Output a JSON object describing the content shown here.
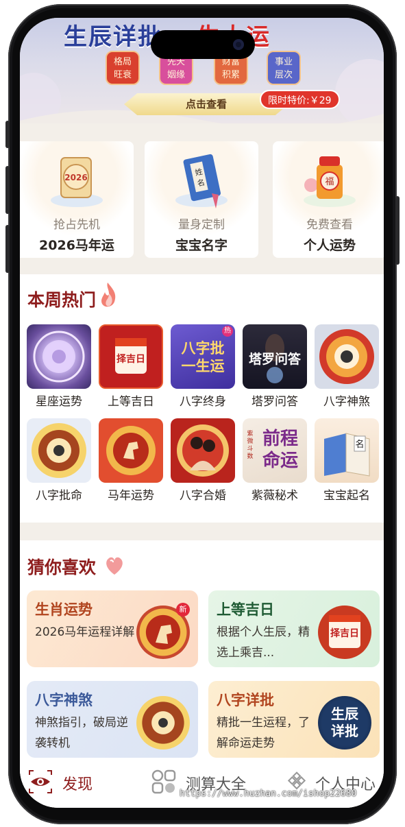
{
  "banner": {
    "title_part1": "生辰详批",
    "title_part2": "一生大运",
    "tags": [
      {
        "line1": "格局",
        "line2": "旺衰"
      },
      {
        "line1": "先天",
        "line2": "姻缘"
      },
      {
        "line1": "财富",
        "line2": "积累"
      },
      {
        "line1": "事业",
        "line2": "层次"
      }
    ],
    "button_label": "点击查看",
    "price_label": "限时特价:￥29"
  },
  "feature_cards": [
    {
      "subtitle": "抢占先机",
      "title": "2026马年运",
      "art_text": "2026"
    },
    {
      "subtitle": "量身定制",
      "title": "宝宝名字",
      "art_text": "姓名"
    },
    {
      "subtitle": "免费查看",
      "title": "个人运势",
      "art_text": "福"
    }
  ],
  "hot": {
    "title": "本周热门",
    "items": [
      {
        "label": "星座运势",
        "icon": "zodiac-wheel-icon"
      },
      {
        "label": "上等吉日",
        "icon": "calendar-icon",
        "icon_text": "择吉日"
      },
      {
        "label": "八字终身",
        "icon": "bazi-book-icon",
        "icon_text": "八字批一生运",
        "badge": "热"
      },
      {
        "label": "塔罗问答",
        "icon": "tarot-icon",
        "icon_text": "塔罗问答"
      },
      {
        "label": "八字神煞",
        "icon": "bagua-wheel-icon"
      },
      {
        "label": "八字批命",
        "icon": "yinyang-icon"
      },
      {
        "label": "马年运势",
        "icon": "horse-icon"
      },
      {
        "label": "八字合婚",
        "icon": "couple-icon"
      },
      {
        "label": "紫薇秘术",
        "icon": "fortune-icon",
        "icon_text": "前程命运",
        "icon_side_text": "紫微斗数"
      },
      {
        "label": "宝宝起名",
        "icon": "name-book-icon",
        "icon_text": "名"
      }
    ]
  },
  "guess": {
    "title": "猜你喜欢",
    "cards": [
      {
        "title": "生肖运势",
        "desc": "2026马年运程详解",
        "icon": "horse-icon",
        "badge": "新"
      },
      {
        "title": "上等吉日",
        "desc": "根据个人生辰，精选上乘吉...",
        "icon": "calendar-icon",
        "icon_text": "择吉日"
      },
      {
        "title": "八字神煞",
        "desc": "神煞指引，破局逆袭转机",
        "icon": "yinyang-icon"
      },
      {
        "title": "八字详批",
        "desc": "精批一生运程，了解命运走势",
        "icon": "shengchen-icon",
        "icon_text": "生辰详批"
      }
    ]
  },
  "tabbar": {
    "tabs": [
      {
        "label": "发现",
        "icon": "eye-icon",
        "active": true
      },
      {
        "label": "测算大全",
        "icon": "grid-icon",
        "active": false
      },
      {
        "label": "个人中心",
        "icon": "user-knot-icon",
        "active": false
      }
    ]
  },
  "watermark": "https://www.huzhan.com/ishop22680",
  "colors": {
    "accent": "#8e1d1d",
    "price_red": "#e0352b",
    "page_bg": "#f3efe9"
  }
}
